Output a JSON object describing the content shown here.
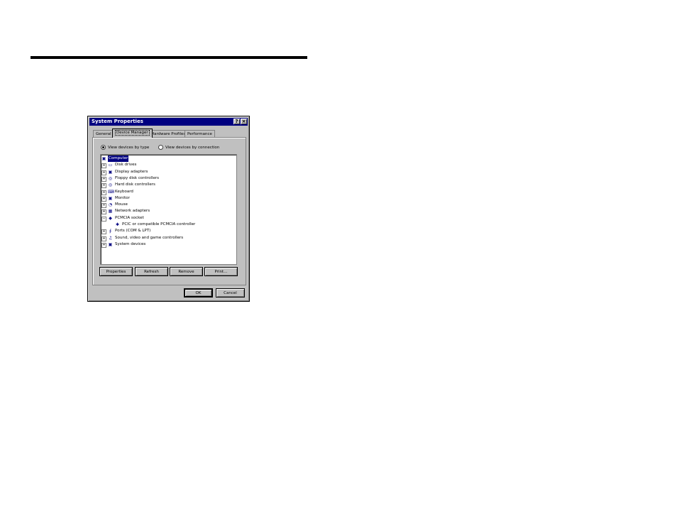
{
  "window": {
    "title": "System Properties",
    "help_btn": "?",
    "close_btn": "×"
  },
  "tabs": [
    "General",
    "Device Manager",
    "Hardware Profiles",
    "Performance"
  ],
  "view_options": {
    "by_type": "View devices by type",
    "by_connection": "View devices by connection",
    "selected": "by_type"
  },
  "devices": [
    {
      "label": "Computer",
      "expander": "",
      "icon": "computer-icon",
      "glyph": "▣",
      "selected": true,
      "level": 0
    },
    {
      "label": "Disk drives",
      "expander": "+",
      "icon": "disk-drive-icon",
      "glyph": "▭",
      "level": 1
    },
    {
      "label": "Display adapters",
      "expander": "+",
      "icon": "display-icon",
      "glyph": "▣",
      "level": 1
    },
    {
      "label": "Floppy disk controllers",
      "expander": "+",
      "icon": "controller-icon",
      "glyph": "◎",
      "level": 1
    },
    {
      "label": "Hard disk controllers",
      "expander": "+",
      "icon": "controller-icon",
      "glyph": "◎",
      "level": 1
    },
    {
      "label": "Keyboard",
      "expander": "+",
      "icon": "keyboard-icon",
      "glyph": "⌨",
      "level": 1
    },
    {
      "label": "Monitor",
      "expander": "+",
      "icon": "monitor-icon",
      "glyph": "▣",
      "level": 1
    },
    {
      "label": "Mouse",
      "expander": "+",
      "icon": "mouse-icon",
      "glyph": "◔",
      "level": 1
    },
    {
      "label": "Network adapters",
      "expander": "+",
      "icon": "network-icon",
      "glyph": "▦",
      "level": 1
    },
    {
      "label": "PCMCIA socket",
      "expander": "−",
      "icon": "pcmcia-icon",
      "glyph": "◆",
      "level": 1
    },
    {
      "label": "PCIC or compatible PCMCIA controller",
      "expander": "",
      "icon": "pcmcia-controller-icon",
      "glyph": "✱",
      "level": 2
    },
    {
      "label": "Ports (COM & LPT)",
      "expander": "+",
      "icon": "port-icon",
      "glyph": "∮",
      "level": 1
    },
    {
      "label": "Sound, video and game controllers",
      "expander": "+",
      "icon": "sound-icon",
      "glyph": "♫",
      "level": 1
    },
    {
      "label": "System devices",
      "expander": "+",
      "icon": "system-devices-icon",
      "glyph": "▣",
      "level": 1
    }
  ],
  "buttons": {
    "properties": "Properties",
    "refresh": "Refresh",
    "remove": "Remove",
    "print": "Print...",
    "ok": "OK",
    "cancel": "Cancel"
  },
  "colors": {
    "titlebar": "#000080",
    "face": "#c0c0c0",
    "selection": "#000080"
  }
}
